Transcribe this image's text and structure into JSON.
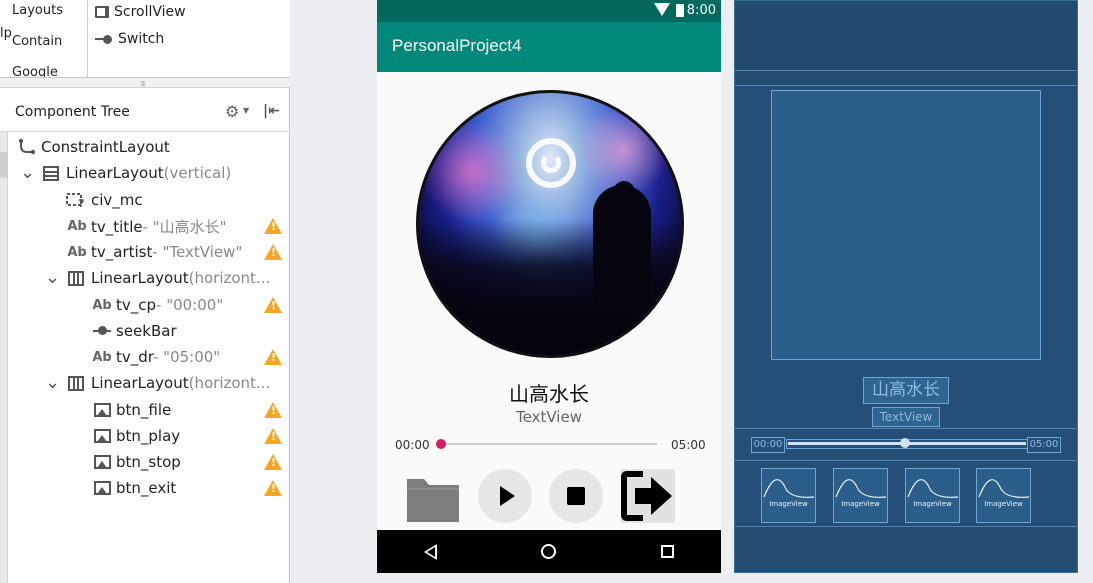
{
  "palette": {
    "categories": [
      "Layouts",
      "Contain",
      "Google"
    ],
    "edge_fragment": "lp",
    "items": [
      {
        "label": "ScrollView",
        "icon": "scrollview-icon"
      },
      {
        "label": "Switch",
        "icon": "switch-icon"
      }
    ]
  },
  "component_tree": {
    "title": "Component Tree",
    "nodes": [
      {
        "label": "ConstraintLayout",
        "meta": "",
        "icon": "constraint-layout-icon",
        "depth": 0,
        "expand": "",
        "warning": false
      },
      {
        "label": "LinearLayout",
        "meta": "(vertical)",
        "icon": "linear-vertical-icon",
        "depth": 1,
        "expand": "v",
        "warning": false
      },
      {
        "label": "civ_mc",
        "meta": "",
        "icon": "custom-view-icon",
        "depth": 2,
        "expand": "",
        "warning": false
      },
      {
        "label": "tv_title",
        "meta": "- \"山高水长\"",
        "icon": "text-view-icon",
        "depth": 2,
        "expand": "",
        "warning": true
      },
      {
        "label": "tv_artist",
        "meta": "- \"TextView\"",
        "icon": "text-view-icon",
        "depth": 2,
        "expand": "",
        "warning": true
      },
      {
        "label": "LinearLayout",
        "meta": "(horizont...",
        "icon": "linear-horizontal-icon",
        "depth": 2,
        "expand": "v",
        "warning": false
      },
      {
        "label": "tv_cp",
        "meta": "- \"00:00\"",
        "icon": "text-view-icon",
        "depth": 3,
        "expand": "",
        "warning": true
      },
      {
        "label": "seekBar",
        "meta": "",
        "icon": "seekbar-icon",
        "depth": 3,
        "expand": "",
        "warning": false
      },
      {
        "label": "tv_dr",
        "meta": "- \"05:00\"",
        "icon": "text-view-icon",
        "depth": 3,
        "expand": "",
        "warning": true
      },
      {
        "label": "LinearLayout",
        "meta": "(horizont...",
        "icon": "linear-horizontal-icon",
        "depth": 2,
        "expand": "v",
        "warning": false
      },
      {
        "label": "btn_file",
        "meta": "",
        "icon": "image-view-icon",
        "depth": 3,
        "expand": "",
        "warning": true
      },
      {
        "label": "btn_play",
        "meta": "",
        "icon": "image-view-icon",
        "depth": 3,
        "expand": "",
        "warning": true
      },
      {
        "label": "btn_stop",
        "meta": "",
        "icon": "image-view-icon",
        "depth": 3,
        "expand": "",
        "warning": true
      },
      {
        "label": "btn_exit",
        "meta": "",
        "icon": "image-view-icon",
        "depth": 3,
        "expand": "",
        "warning": true
      }
    ]
  },
  "phone": {
    "status_time": "8:00",
    "app_title": "PersonalProject4",
    "song_title": "山高水长",
    "song_artist": "TextView",
    "current_time": "00:00",
    "duration": "05:00",
    "progress": 0.0,
    "buttons": [
      "folder-icon",
      "play-icon",
      "stop-icon",
      "exit-icon"
    ],
    "nav": [
      "back-icon",
      "home-icon",
      "recents-icon"
    ],
    "colors": {
      "status_bar": "#00695c",
      "app_bar": "#00897b",
      "seek_thumb": "#d81b60"
    }
  },
  "blueprint": {
    "title": "山高水长",
    "artist": "TextView",
    "time_start": "00:00",
    "time_end": "05:00",
    "button_label": "ImageView",
    "button_count": 4,
    "colors": {
      "background": "#244b70",
      "outline": "#6fa6d6"
    }
  }
}
